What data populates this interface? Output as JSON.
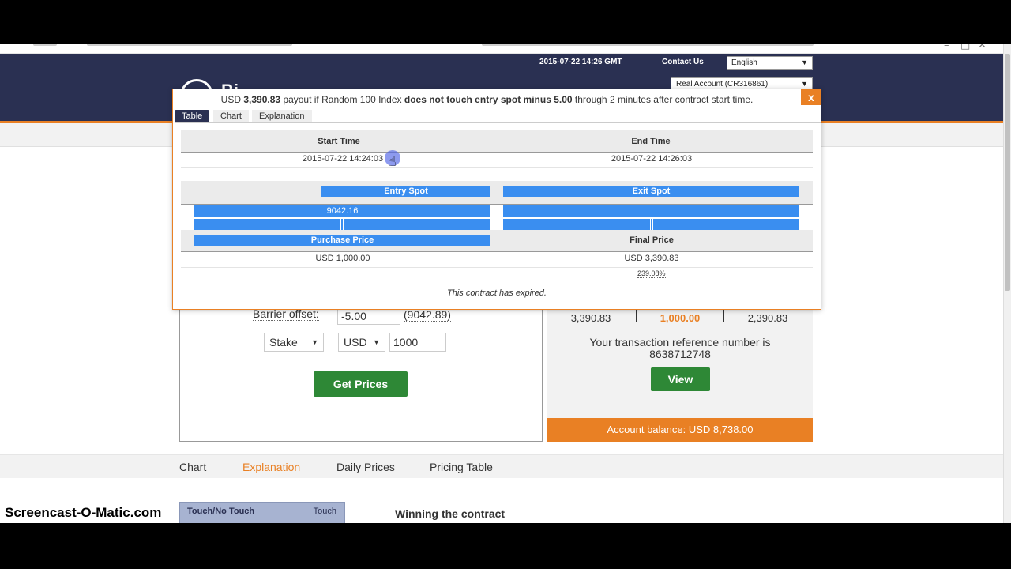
{
  "topbar": {
    "datetime": "2015-07-22 14:26 GMT",
    "contact_label": "Contact Us",
    "language": "English"
  },
  "header": {
    "logo_text": "Bi",
    "account": "Real Account (CR316861)"
  },
  "form": {
    "barrier_label": "Barrier offset:",
    "barrier_value": "-5.00",
    "barrier_absolute": "(9042.89)",
    "stake_type": "Stake",
    "currency": "USD",
    "amount": "1000",
    "get_prices_label": "Get Prices"
  },
  "result": {
    "payout": "3,390.83",
    "cost": "1,000.00",
    "profit": "2,390.83",
    "reference_text": "Your transaction reference number is",
    "reference_number": "8638712748",
    "view_label": "View",
    "balance": "Account balance: USD 8,738.00"
  },
  "bottom_tabs": [
    "Chart",
    "Explanation",
    "Daily Prices",
    "Pricing Table"
  ],
  "active_bottom_tab": "Explanation",
  "touch_card": {
    "title": "Touch/No Touch",
    "right": "Touch"
  },
  "winning_heading": "Winning the contract",
  "modal": {
    "title_pre": "USD",
    "title_amount": "3,390.83",
    "title_mid": "payout if Random 100 Index",
    "title_cond": "does not touch entry spot minus 5.00",
    "title_post": "through 2 minutes after contract start time.",
    "close_label": "x",
    "tabs": [
      "Table",
      "Chart",
      "Explanation"
    ],
    "active_tab": "Table",
    "start_time_label": "Start Time",
    "end_time_label": "End Time",
    "start_time": "2015-07-22 14:24:03",
    "end_time": "2015-07-22 14:26:03",
    "entry_spot_label": "Entry Spot",
    "exit_spot_label": "Exit Spot",
    "entry_spot": "9042.16",
    "purchase_price_label": "Purchase Price",
    "final_price_label": "Final Price",
    "purchase_price": "USD 1,000.00",
    "final_price": "USD 3,390.83",
    "return_pct": "239.08%",
    "status": "This contract has expired."
  },
  "watermark": "Screencast-O-Matic.com",
  "colors": {
    "navy": "#2a3052",
    "orange": "#e98024",
    "green": "#2e8836",
    "highlight_blue": "#3a8ef0"
  }
}
